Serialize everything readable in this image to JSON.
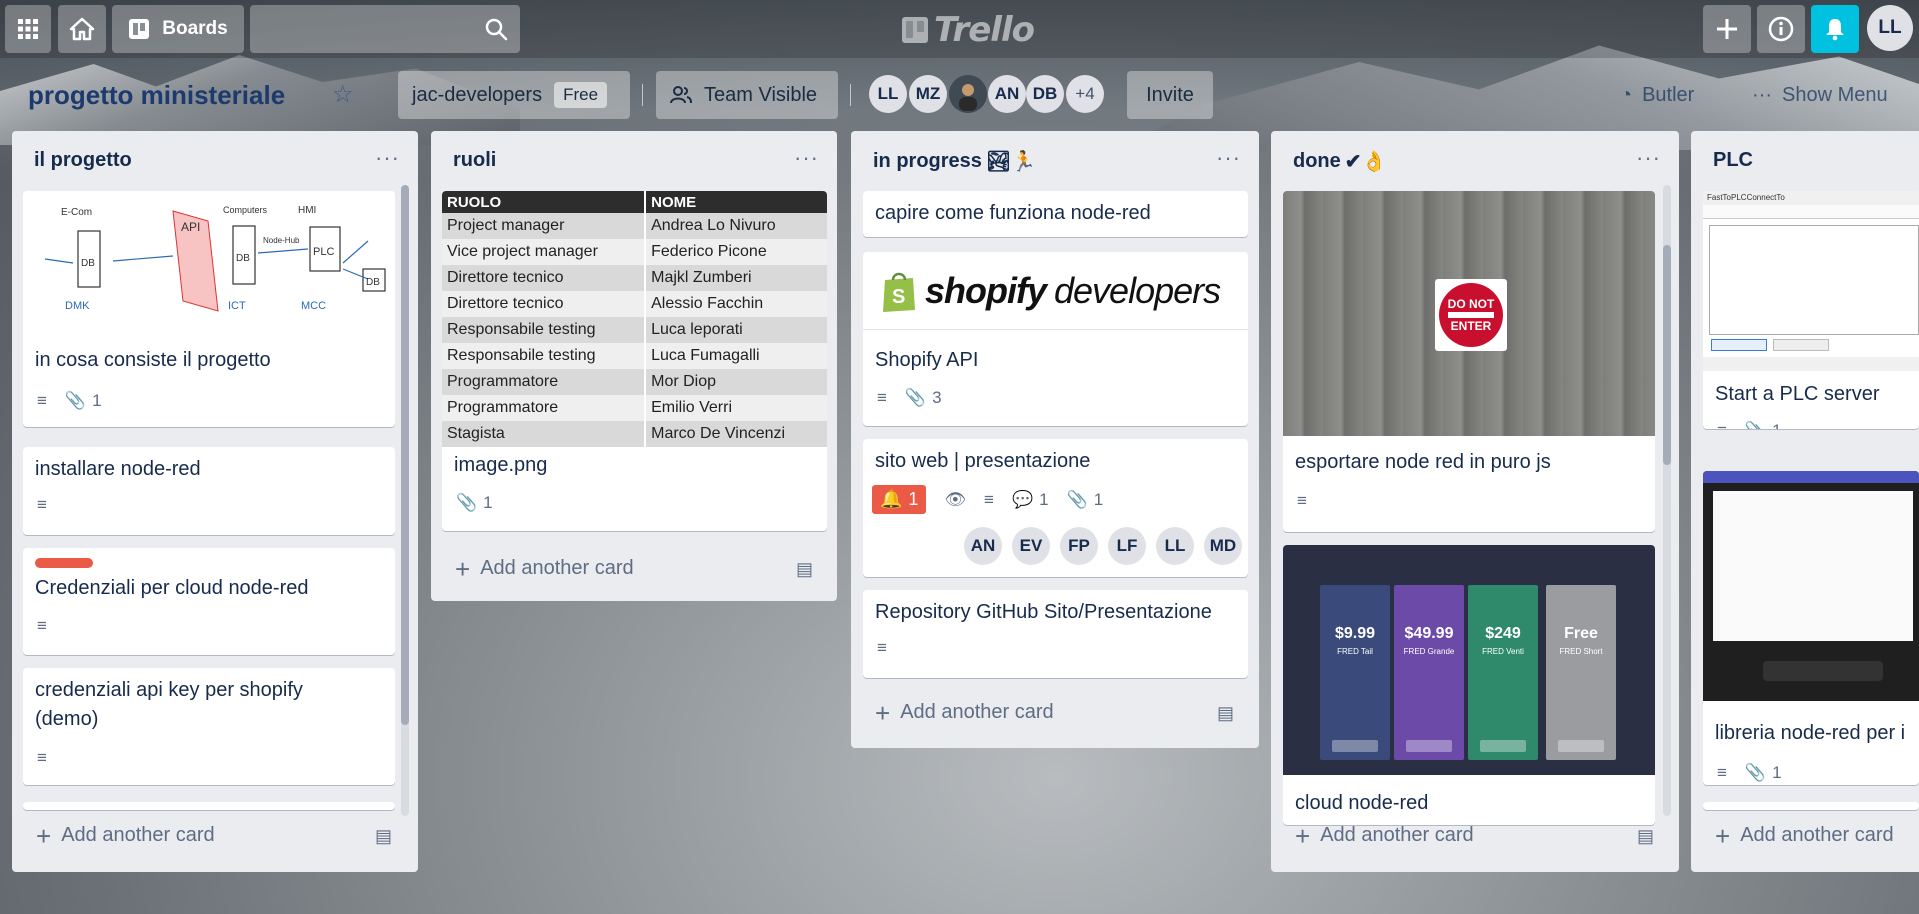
{
  "topbar": {
    "boards_label": "Boards",
    "logo_text": "Trello",
    "user_initials": "LL"
  },
  "board": {
    "title": "progetto ministeriale",
    "team_name": "jac-developers",
    "team_plan": "Free",
    "visibility": "Team Visible",
    "members": [
      "LL",
      "MZ",
      "",
      "AN",
      "DB",
      "+4"
    ],
    "invite_label": "Invite",
    "butler_label": "Butler",
    "show_menu_label": "Show Menu"
  },
  "lists": [
    {
      "title": "il progetto",
      "cards": [
        {
          "title": "in cosa consiste il progetto",
          "attachments": "1"
        },
        {
          "title": "installare node-red"
        },
        {
          "title": "Credenziali per cloud node-red"
        },
        {
          "title": "credenziali api key per shopify (demo)"
        }
      ],
      "add_label": "Add another card",
      "sketch_labels": [
        "E-Com",
        "API",
        "Computers",
        "Node-Hub",
        "HMI",
        "DB",
        "DB",
        "PLC",
        "DB",
        "DMK",
        "ICT",
        "MCC"
      ]
    },
    {
      "title": "ruoli",
      "table": {
        "headers": [
          "RUOLO",
          "NOME"
        ],
        "rows": [
          [
            "Project manager",
            "Andrea Lo Nivuro"
          ],
          [
            "Vice project manager",
            "Federico Picone"
          ],
          [
            "Direttore tecnico",
            "Majkl Zumberi"
          ],
          [
            "Direttore tecnico",
            "Alessio Facchin"
          ],
          [
            "Responsabile testing",
            "Luca leporati"
          ],
          [
            "Responsabile testing",
            "Luca Fumagalli"
          ],
          [
            "Programmatore",
            "Mor Diop"
          ],
          [
            "Programmatore",
            "Emilio Verri"
          ],
          [
            "Stagista",
            "Marco De Vincenzi"
          ]
        ]
      },
      "cards": [
        {
          "title": "image.png",
          "attachments": "1"
        }
      ],
      "add_label": "Add another card"
    },
    {
      "title": "in progress",
      "title_emoji": "🏞🏃",
      "cards": [
        {
          "title": "capire come funziona node-red"
        },
        {
          "title": "Shopify API",
          "attachments": "3",
          "cover_brand": "shopify",
          "cover_sub": "developers"
        },
        {
          "title": "sito web | presentazione",
          "notifications": "1",
          "comments": "1",
          "attachments": "1",
          "members": [
            "AN",
            "EV",
            "FP",
            "LF",
            "LL",
            "MD"
          ]
        },
        {
          "title": "Repository GitHub Sito/Presentazione"
        }
      ],
      "add_label": "Add another card"
    },
    {
      "title": "done",
      "title_emoji": "✔👌",
      "cards": [
        {
          "title": "esportare node red in puro js",
          "sign_top": "DO NOT",
          "sign_bottom": "ENTER"
        },
        {
          "title": "cloud node-red",
          "pricing": [
            {
              "name": "FRED Tail",
              "price": "$9.99"
            },
            {
              "name": "FRED Grande",
              "price": "$49.99"
            },
            {
              "name": "FRED Venti",
              "price": "$249"
            },
            {
              "name": "FRED Short",
              "price": "Free"
            }
          ]
        }
      ],
      "add_label": "Add another card"
    },
    {
      "title": "PLC",
      "cards": [
        {
          "title": "Start a PLC server",
          "attachments": "1",
          "window_title": "FastToPLCConnectTo"
        },
        {
          "title": "libreria node-red per i",
          "attachments": "1"
        }
      ],
      "add_label": "Add another card"
    }
  ],
  "colors": {
    "list_bg": "#ebecf0",
    "label_red": "#eb5a46",
    "bell_accent": "#00c2e0"
  }
}
